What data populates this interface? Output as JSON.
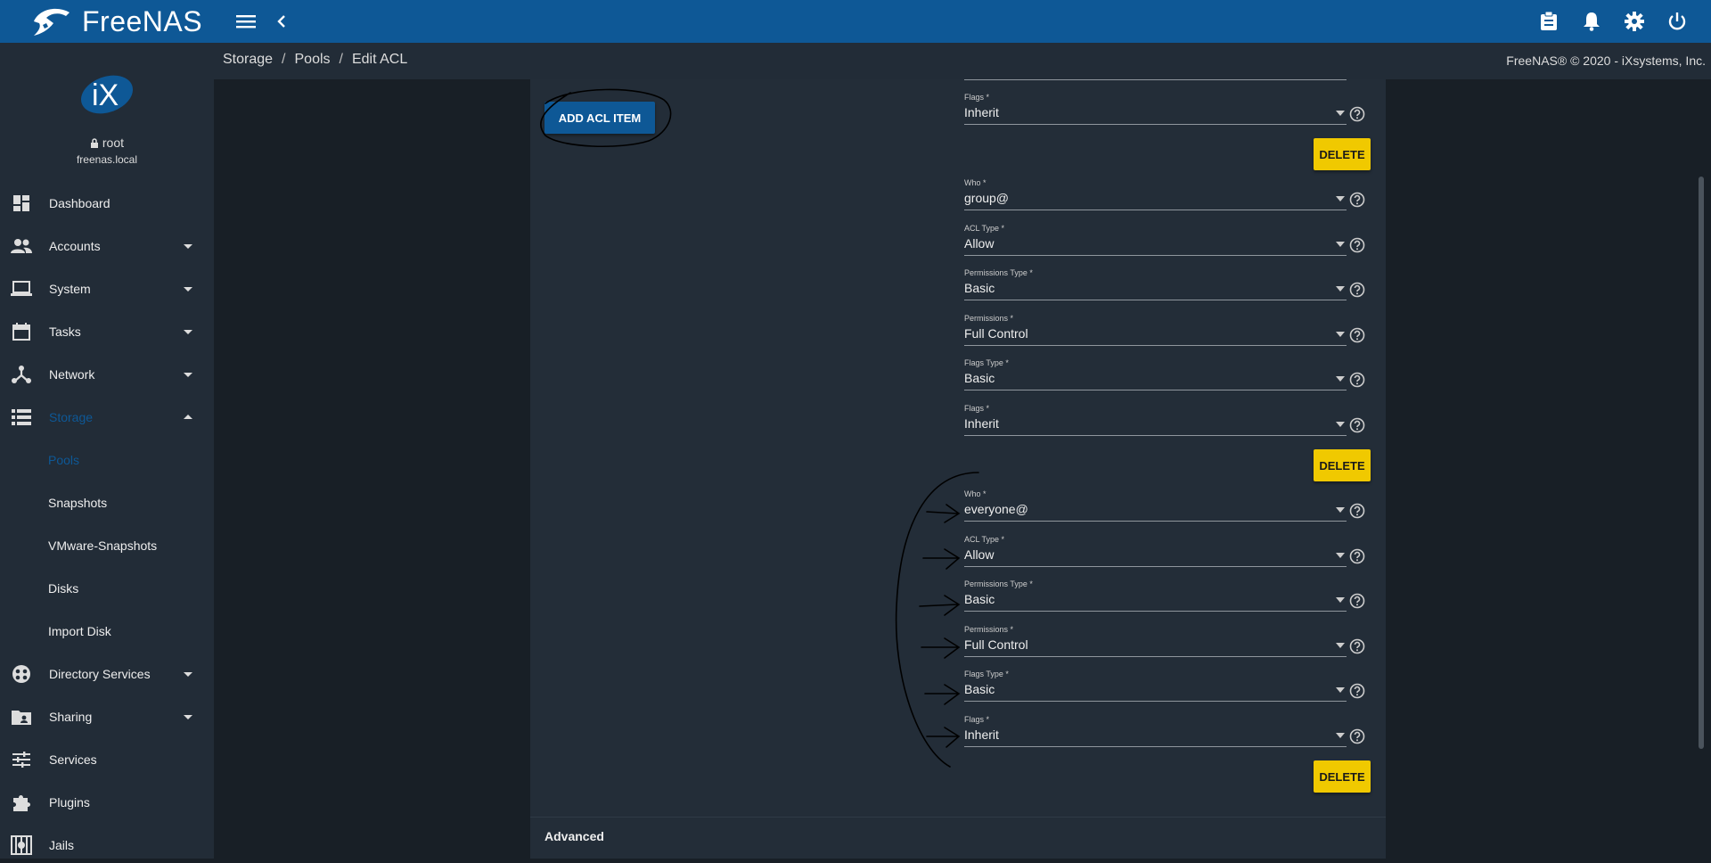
{
  "app": {
    "name": "FreeNAS"
  },
  "topbar": {
    "menu_icon": "hamburger-icon",
    "collapse_icon": "chevron-left-icon",
    "right_icons": [
      "clipboard-icon",
      "bell-icon",
      "gear-icon",
      "power-icon"
    ]
  },
  "breadcrumb": [
    "Storage",
    "Pools",
    "Edit ACL"
  ],
  "copyright": "FreeNAS® © 2020 - iXsystems, Inc.",
  "user": {
    "name": "root",
    "host": "freenas.local"
  },
  "sidebar": {
    "items": [
      {
        "label": "Dashboard",
        "icon": "dashboard-icon",
        "caret": false
      },
      {
        "label": "Accounts",
        "icon": "accounts-icon",
        "caret": true
      },
      {
        "label": "System",
        "icon": "laptop-icon",
        "caret": true
      },
      {
        "label": "Tasks",
        "icon": "calendar-icon",
        "caret": true
      },
      {
        "label": "Network",
        "icon": "network-icon",
        "caret": true
      },
      {
        "label": "Storage",
        "icon": "storage-icon",
        "caret": true,
        "active": true
      },
      {
        "label": "Directory Services",
        "icon": "directory-icon",
        "caret": true
      },
      {
        "label": "Sharing",
        "icon": "sharing-icon",
        "caret": true
      },
      {
        "label": "Services",
        "icon": "sliders-icon",
        "caret": false
      },
      {
        "label": "Plugins",
        "icon": "puzzle-icon",
        "caret": false
      },
      {
        "label": "Jails",
        "icon": "jail-icon",
        "caret": false
      }
    ],
    "storage_sub": [
      "Pools",
      "Snapshots",
      "VMware-Snapshots",
      "Disks",
      "Import Disk"
    ]
  },
  "colors": {
    "topbar": "#0e5896",
    "accent_active": "#0e5896",
    "delete_button": "#f0c900",
    "sidebar": "#222c37",
    "card": "#232d38"
  },
  "form": {
    "add_button": "ADD ACL ITEM",
    "delete_label": "DELETE",
    "advanced_label": "Advanced",
    "top_partial": {
      "label": "Flags *",
      "value": "Inherit"
    },
    "entries": [
      {
        "fields": [
          {
            "label": "Who *",
            "value": "group@"
          },
          {
            "label": "ACL Type *",
            "value": "Allow"
          },
          {
            "label": "Permissions Type *",
            "value": "Basic"
          },
          {
            "label": "Permissions *",
            "value": "Full Control"
          },
          {
            "label": "Flags Type *",
            "value": "Basic"
          },
          {
            "label": "Flags *",
            "value": "Inherit"
          }
        ]
      },
      {
        "fields": [
          {
            "label": "Who *",
            "value": "everyone@"
          },
          {
            "label": "ACL Type *",
            "value": "Allow"
          },
          {
            "label": "Permissions Type *",
            "value": "Basic"
          },
          {
            "label": "Permissions *",
            "value": "Full Control"
          },
          {
            "label": "Flags Type *",
            "value": "Basic"
          },
          {
            "label": "Flags *",
            "value": "Inherit"
          }
        ]
      }
    ]
  }
}
